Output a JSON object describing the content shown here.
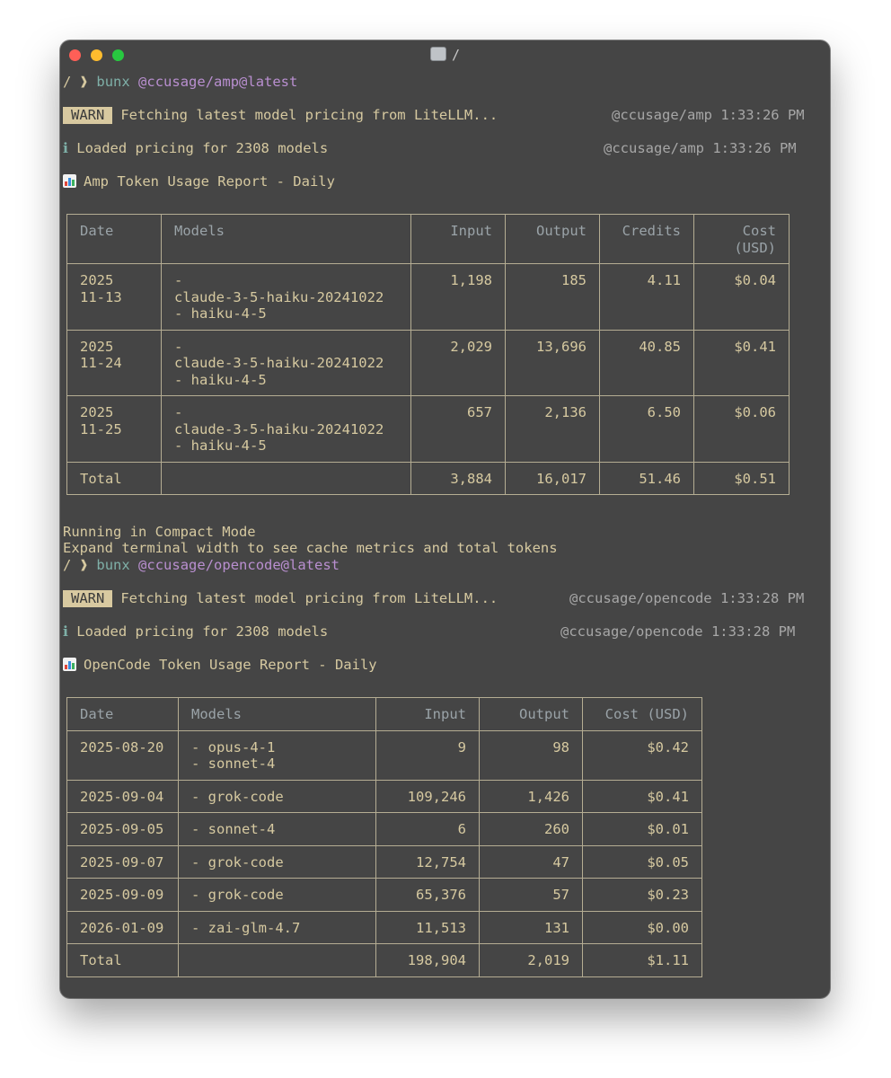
{
  "window": {
    "title": "/"
  },
  "amp": {
    "prompt": {
      "cwd": "/",
      "arrow": "❱",
      "command": "bunx",
      "package": "@ccusage/amp@latest"
    },
    "warn": {
      "badge": "WARN",
      "message": "Fetching latest model pricing from LiteLLM...",
      "meta": "@ccusage/amp 1:33:26 PM"
    },
    "info": {
      "icon": "ℹ",
      "message": "Loaded pricing for 2308 models",
      "meta": "@ccusage/amp 1:33:26 PM"
    },
    "report_title": "Amp Token Usage Report - Daily",
    "table": {
      "headers": [
        "Date",
        "Models",
        "Input",
        "Output",
        "Credits",
        "Cost\n(USD)"
      ],
      "rows": [
        {
          "date": [
            "2025",
            "11-13"
          ],
          "models": [
            "-",
            "claude-3-5-haiku-20241022",
            "- haiku-4-5"
          ],
          "input": "1,198",
          "output": "185",
          "credits": "4.11",
          "cost": "$0.04"
        },
        {
          "date": [
            "2025",
            "11-24"
          ],
          "models": [
            "-",
            "claude-3-5-haiku-20241022",
            "- haiku-4-5"
          ],
          "input": "2,029",
          "output": "13,696",
          "credits": "40.85",
          "cost": "$0.41"
        },
        {
          "date": [
            "2025",
            "11-25"
          ],
          "models": [
            "-",
            "claude-3-5-haiku-20241022",
            "- haiku-4-5"
          ],
          "input": "657",
          "output": "2,136",
          "credits": "6.50",
          "cost": "$0.06"
        }
      ],
      "total": {
        "label": "Total",
        "input": "3,884",
        "output": "16,017",
        "credits": "51.46",
        "cost": "$0.51"
      }
    },
    "compact_line1": "Running in Compact Mode",
    "compact_line2": "Expand terminal width to see cache metrics and total tokens"
  },
  "opencode": {
    "prompt": {
      "cwd": "/",
      "arrow": "❱",
      "command": "bunx",
      "package": "@ccusage/opencode@latest"
    },
    "warn": {
      "badge": "WARN",
      "message": "Fetching latest model pricing from LiteLLM...",
      "meta": "@ccusage/opencode 1:33:28 PM"
    },
    "info": {
      "icon": "ℹ",
      "message": "Loaded pricing for 2308 models",
      "meta": "@ccusage/opencode 1:33:28 PM"
    },
    "report_title": "OpenCode Token Usage Report - Daily",
    "table": {
      "headers": [
        "Date",
        "Models",
        "Input",
        "Output",
        "Cost (USD)"
      ],
      "rows": [
        {
          "date": "2025-08-20",
          "models": [
            "- opus-4-1",
            "- sonnet-4"
          ],
          "input": "9",
          "output": "98",
          "cost": "$0.42"
        },
        {
          "date": "2025-09-04",
          "models": [
            "- grok-code"
          ],
          "input": "109,246",
          "output": "1,426",
          "cost": "$0.41"
        },
        {
          "date": "2025-09-05",
          "models": [
            "- sonnet-4"
          ],
          "input": "6",
          "output": "260",
          "cost": "$0.01"
        },
        {
          "date": "2025-09-07",
          "models": [
            "- grok-code"
          ],
          "input": "12,754",
          "output": "47",
          "cost": "$0.05"
        },
        {
          "date": "2025-09-09",
          "models": [
            "- grok-code"
          ],
          "input": "65,376",
          "output": "57",
          "cost": "$0.23"
        },
        {
          "date": "2026-01-09",
          "models": [
            "- zai-glm-4.7"
          ],
          "input": "11,513",
          "output": "131",
          "cost": "$0.00"
        }
      ],
      "total": {
        "label": "Total",
        "input": "198,904",
        "output": "2,019",
        "cost": "$1.11"
      }
    }
  }
}
